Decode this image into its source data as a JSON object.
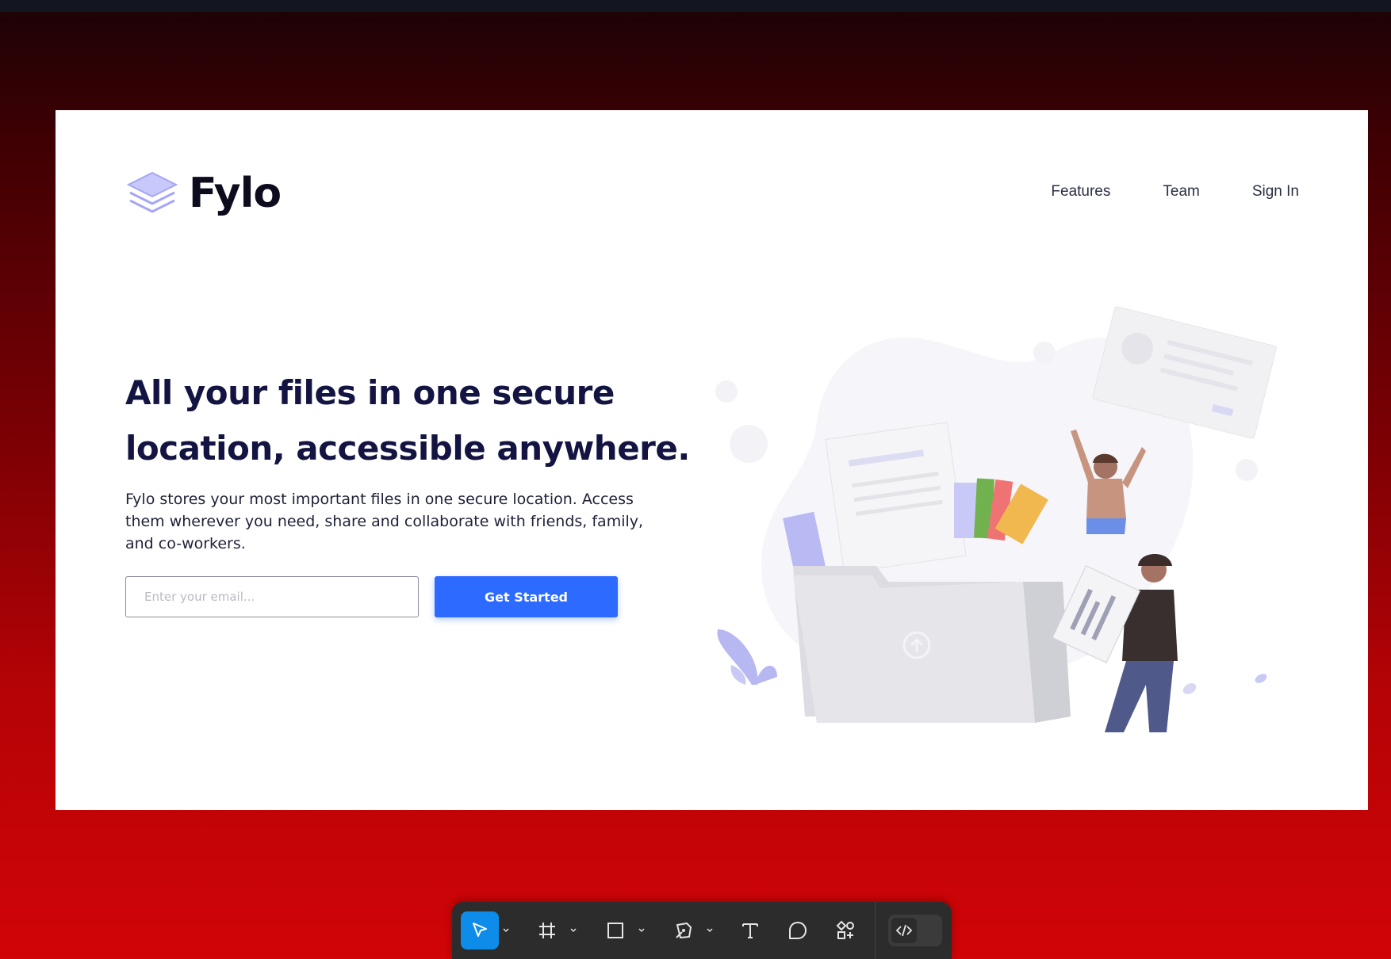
{
  "brand": {
    "name": "Fylo",
    "logo_icon": "layers-icon",
    "accent_color": "#2d6aff"
  },
  "nav": {
    "items": [
      "Features",
      "Team",
      "Sign In"
    ]
  },
  "hero": {
    "headline": "All your files in one secure location, accessible anywhere.",
    "description": "Fylo stores your most important files in one secure location. Access them wherever you need, share and collaborate with friends, family, and co-workers.",
    "email_placeholder": "Enter your email...",
    "cta_label": "Get Started",
    "illustration": "people-with-file-folder-illustration"
  },
  "toolbar": {
    "tools": [
      "move-tool",
      "frame-tool",
      "rectangle-tool",
      "pen-tool",
      "text-tool",
      "comment-tool",
      "components-tool"
    ],
    "active_tool": "move-tool",
    "dev_mode_icon": "code-icon"
  }
}
